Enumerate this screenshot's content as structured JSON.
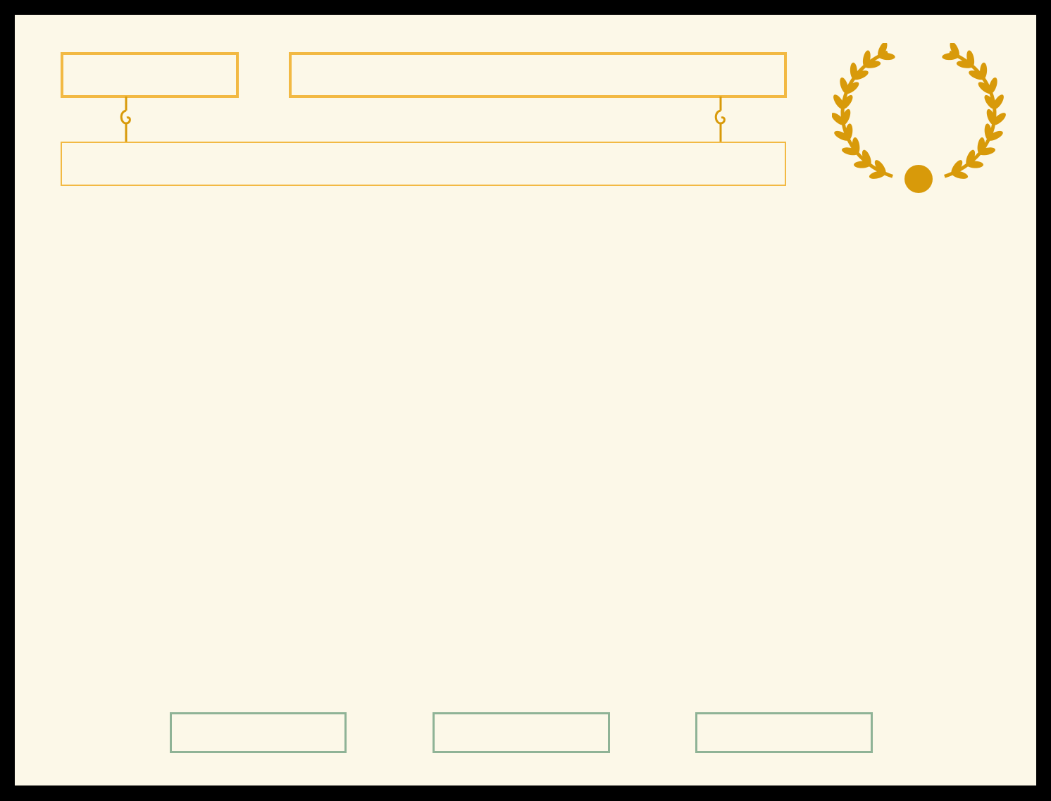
{
  "colors": {
    "background": "#fcf8e8",
    "frame": "#000000",
    "gold_outline": "#f2b943",
    "gold_dark": "#d89a0a",
    "green_outline": "#8fb396"
  },
  "header": {
    "left_box_text": "",
    "right_box_text": ""
  },
  "banner": {
    "text": ""
  },
  "footer": {
    "slot_1_text": "",
    "slot_2_text": "",
    "slot_3_text": ""
  },
  "emblem": {
    "icon": "laurel-wreath-icon"
  }
}
